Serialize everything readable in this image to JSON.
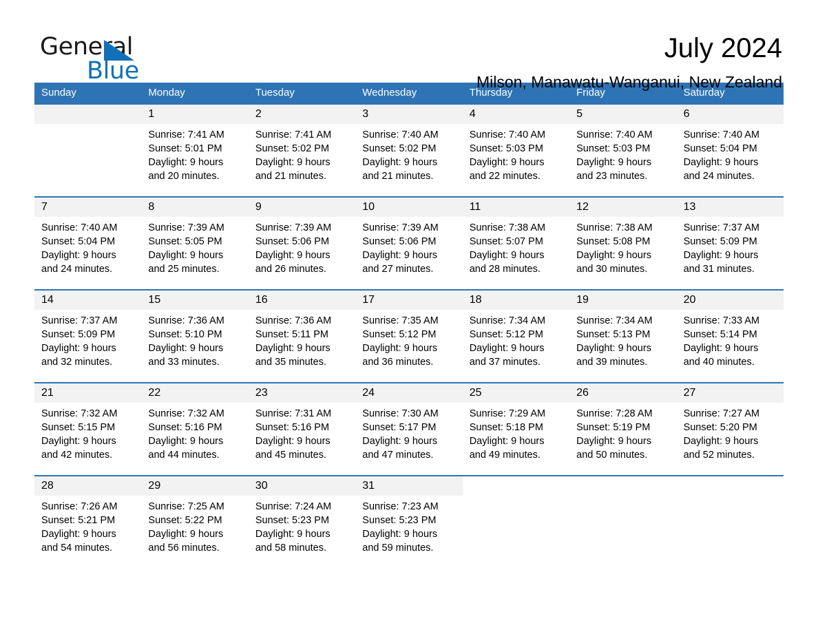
{
  "logo": {
    "word_one": "General",
    "word_two": "Blue",
    "triangle_color": "#1270b8"
  },
  "header": {
    "title": "July 2024",
    "subtitle": "Milson, Manawatu-Wanganui, New Zealand"
  },
  "theme": {
    "header_blue": "#2e74b5",
    "daynum_band": "#f2f2f2",
    "text": "#000000"
  },
  "calendar": {
    "weekdays": [
      "Sunday",
      "Monday",
      "Tuesday",
      "Wednesday",
      "Thursday",
      "Friday",
      "Saturday"
    ],
    "weeks": [
      [
        {
          "day": "",
          "sunrise": "",
          "sunset": "",
          "daylight_line1": "",
          "daylight_line2": ""
        },
        {
          "day": "1",
          "sunrise": "Sunrise: 7:41 AM",
          "sunset": "Sunset: 5:01 PM",
          "daylight_line1": "Daylight: 9 hours",
          "daylight_line2": "and 20 minutes."
        },
        {
          "day": "2",
          "sunrise": "Sunrise: 7:41 AM",
          "sunset": "Sunset: 5:02 PM",
          "daylight_line1": "Daylight: 9 hours",
          "daylight_line2": "and 21 minutes."
        },
        {
          "day": "3",
          "sunrise": "Sunrise: 7:40 AM",
          "sunset": "Sunset: 5:02 PM",
          "daylight_line1": "Daylight: 9 hours",
          "daylight_line2": "and 21 minutes."
        },
        {
          "day": "4",
          "sunrise": "Sunrise: 7:40 AM",
          "sunset": "Sunset: 5:03 PM",
          "daylight_line1": "Daylight: 9 hours",
          "daylight_line2": "and 22 minutes."
        },
        {
          "day": "5",
          "sunrise": "Sunrise: 7:40 AM",
          "sunset": "Sunset: 5:03 PM",
          "daylight_line1": "Daylight: 9 hours",
          "daylight_line2": "and 23 minutes."
        },
        {
          "day": "6",
          "sunrise": "Sunrise: 7:40 AM",
          "sunset": "Sunset: 5:04 PM",
          "daylight_line1": "Daylight: 9 hours",
          "daylight_line2": "and 24 minutes."
        }
      ],
      [
        {
          "day": "7",
          "sunrise": "Sunrise: 7:40 AM",
          "sunset": "Sunset: 5:04 PM",
          "daylight_line1": "Daylight: 9 hours",
          "daylight_line2": "and 24 minutes."
        },
        {
          "day": "8",
          "sunrise": "Sunrise: 7:39 AM",
          "sunset": "Sunset: 5:05 PM",
          "daylight_line1": "Daylight: 9 hours",
          "daylight_line2": "and 25 minutes."
        },
        {
          "day": "9",
          "sunrise": "Sunrise: 7:39 AM",
          "sunset": "Sunset: 5:06 PM",
          "daylight_line1": "Daylight: 9 hours",
          "daylight_line2": "and 26 minutes."
        },
        {
          "day": "10",
          "sunrise": "Sunrise: 7:39 AM",
          "sunset": "Sunset: 5:06 PM",
          "daylight_line1": "Daylight: 9 hours",
          "daylight_line2": "and 27 minutes."
        },
        {
          "day": "11",
          "sunrise": "Sunrise: 7:38 AM",
          "sunset": "Sunset: 5:07 PM",
          "daylight_line1": "Daylight: 9 hours",
          "daylight_line2": "and 28 minutes."
        },
        {
          "day": "12",
          "sunrise": "Sunrise: 7:38 AM",
          "sunset": "Sunset: 5:08 PM",
          "daylight_line1": "Daylight: 9 hours",
          "daylight_line2": "and 30 minutes."
        },
        {
          "day": "13",
          "sunrise": "Sunrise: 7:37 AM",
          "sunset": "Sunset: 5:09 PM",
          "daylight_line1": "Daylight: 9 hours",
          "daylight_line2": "and 31 minutes."
        }
      ],
      [
        {
          "day": "14",
          "sunrise": "Sunrise: 7:37 AM",
          "sunset": "Sunset: 5:09 PM",
          "daylight_line1": "Daylight: 9 hours",
          "daylight_line2": "and 32 minutes."
        },
        {
          "day": "15",
          "sunrise": "Sunrise: 7:36 AM",
          "sunset": "Sunset: 5:10 PM",
          "daylight_line1": "Daylight: 9 hours",
          "daylight_line2": "and 33 minutes."
        },
        {
          "day": "16",
          "sunrise": "Sunrise: 7:36 AM",
          "sunset": "Sunset: 5:11 PM",
          "daylight_line1": "Daylight: 9 hours",
          "daylight_line2": "and 35 minutes."
        },
        {
          "day": "17",
          "sunrise": "Sunrise: 7:35 AM",
          "sunset": "Sunset: 5:12 PM",
          "daylight_line1": "Daylight: 9 hours",
          "daylight_line2": "and 36 minutes."
        },
        {
          "day": "18",
          "sunrise": "Sunrise: 7:34 AM",
          "sunset": "Sunset: 5:12 PM",
          "daylight_line1": "Daylight: 9 hours",
          "daylight_line2": "and 37 minutes."
        },
        {
          "day": "19",
          "sunrise": "Sunrise: 7:34 AM",
          "sunset": "Sunset: 5:13 PM",
          "daylight_line1": "Daylight: 9 hours",
          "daylight_line2": "and 39 minutes."
        },
        {
          "day": "20",
          "sunrise": "Sunrise: 7:33 AM",
          "sunset": "Sunset: 5:14 PM",
          "daylight_line1": "Daylight: 9 hours",
          "daylight_line2": "and 40 minutes."
        }
      ],
      [
        {
          "day": "21",
          "sunrise": "Sunrise: 7:32 AM",
          "sunset": "Sunset: 5:15 PM",
          "daylight_line1": "Daylight: 9 hours",
          "daylight_line2": "and 42 minutes."
        },
        {
          "day": "22",
          "sunrise": "Sunrise: 7:32 AM",
          "sunset": "Sunset: 5:16 PM",
          "daylight_line1": "Daylight: 9 hours",
          "daylight_line2": "and 44 minutes."
        },
        {
          "day": "23",
          "sunrise": "Sunrise: 7:31 AM",
          "sunset": "Sunset: 5:16 PM",
          "daylight_line1": "Daylight: 9 hours",
          "daylight_line2": "and 45 minutes."
        },
        {
          "day": "24",
          "sunrise": "Sunrise: 7:30 AM",
          "sunset": "Sunset: 5:17 PM",
          "daylight_line1": "Daylight: 9 hours",
          "daylight_line2": "and 47 minutes."
        },
        {
          "day": "25",
          "sunrise": "Sunrise: 7:29 AM",
          "sunset": "Sunset: 5:18 PM",
          "daylight_line1": "Daylight: 9 hours",
          "daylight_line2": "and 49 minutes."
        },
        {
          "day": "26",
          "sunrise": "Sunrise: 7:28 AM",
          "sunset": "Sunset: 5:19 PM",
          "daylight_line1": "Daylight: 9 hours",
          "daylight_line2": "and 50 minutes."
        },
        {
          "day": "27",
          "sunrise": "Sunrise: 7:27 AM",
          "sunset": "Sunset: 5:20 PM",
          "daylight_line1": "Daylight: 9 hours",
          "daylight_line2": "and 52 minutes."
        }
      ],
      [
        {
          "day": "28",
          "sunrise": "Sunrise: 7:26 AM",
          "sunset": "Sunset: 5:21 PM",
          "daylight_line1": "Daylight: 9 hours",
          "daylight_line2": "and 54 minutes."
        },
        {
          "day": "29",
          "sunrise": "Sunrise: 7:25 AM",
          "sunset": "Sunset: 5:22 PM",
          "daylight_line1": "Daylight: 9 hours",
          "daylight_line2": "and 56 minutes."
        },
        {
          "day": "30",
          "sunrise": "Sunrise: 7:24 AM",
          "sunset": "Sunset: 5:23 PM",
          "daylight_line1": "Daylight: 9 hours",
          "daylight_line2": "and 58 minutes."
        },
        {
          "day": "31",
          "sunrise": "Sunrise: 7:23 AM",
          "sunset": "Sunset: 5:23 PM",
          "daylight_line1": "Daylight: 9 hours",
          "daylight_line2": "and 59 minutes."
        },
        {
          "day": "",
          "sunrise": "",
          "sunset": "",
          "daylight_line1": "",
          "daylight_line2": ""
        },
        {
          "day": "",
          "sunrise": "",
          "sunset": "",
          "daylight_line1": "",
          "daylight_line2": ""
        },
        {
          "day": "",
          "sunrise": "",
          "sunset": "",
          "daylight_line1": "",
          "daylight_line2": ""
        }
      ]
    ]
  }
}
